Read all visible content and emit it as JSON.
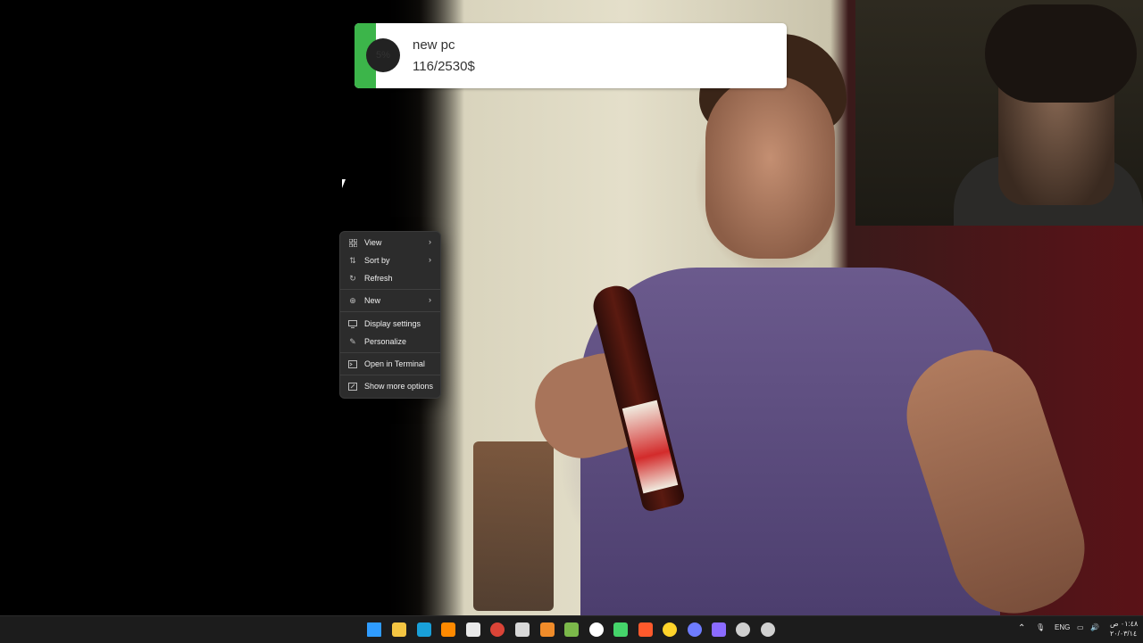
{
  "widget": {
    "percent": "5%",
    "title": "new pc",
    "amount": "116/2530$",
    "progress": 0.05
  },
  "context_menu": {
    "items": [
      {
        "label": "View",
        "icon": "view-grid-icon",
        "submenu": true
      },
      {
        "label": "Sort by",
        "icon": "sort-icon",
        "submenu": true
      },
      {
        "label": "Refresh",
        "icon": "refresh-icon",
        "submenu": false
      },
      {
        "label": "New",
        "icon": "new-plus-icon",
        "submenu": true
      },
      {
        "label": "Display settings",
        "icon": "display-icon",
        "submenu": false
      },
      {
        "label": "Personalize",
        "icon": "pen-icon",
        "submenu": false
      },
      {
        "label": "Open in Terminal",
        "icon": "terminal-icon",
        "submenu": false
      },
      {
        "label": "Show more options",
        "icon": "more-options-icon",
        "submenu": false
      }
    ]
  },
  "taskbar": {
    "apps": [
      {
        "name": "start",
        "icon": "windows-start-icon",
        "color": "#2f9cff"
      },
      {
        "name": "file-explorer",
        "icon": "folder-icon",
        "color": "#f4c542"
      },
      {
        "name": "edge",
        "icon": "edge-icon",
        "color": "#19a0d9"
      },
      {
        "name": "illustrator",
        "icon": "illustrator-icon",
        "color": "#ff8a00"
      },
      {
        "name": "store",
        "icon": "store-icon",
        "color": "#e9e9e9"
      },
      {
        "name": "chrome",
        "icon": "chrome-icon",
        "color": "#db4437"
      },
      {
        "name": "7zip",
        "icon": "7zip-icon",
        "color": "#d8d8d8"
      },
      {
        "name": "blender",
        "icon": "blender-icon",
        "color": "#f08c2a"
      },
      {
        "name": "layers-app",
        "icon": "layers-icon",
        "color": "#7bb84a"
      },
      {
        "name": "chat-app",
        "icon": "chat-bubble-icon",
        "color": "#ffffff"
      },
      {
        "name": "app-lambda",
        "icon": "lambda-icon",
        "color": "#45d46a"
      },
      {
        "name": "brave",
        "icon": "brave-icon",
        "color": "#ff5a2c"
      },
      {
        "name": "yellow-app",
        "icon": "yellow-circle-icon",
        "color": "#ffd42a"
      },
      {
        "name": "discord",
        "icon": "discord-icon",
        "color": "#6e7cff"
      },
      {
        "name": "app-a",
        "icon": "letter-a-icon",
        "color": "#8b6bff"
      },
      {
        "name": "obs",
        "icon": "obs-icon",
        "color": "#cfcfcf"
      },
      {
        "name": "settings",
        "icon": "gear-icon",
        "color": "#d0d0d0"
      }
    ],
    "tray": {
      "language": "ENG",
      "time": "٠١:٤٨ ص",
      "date": "٢٠/٠٣/١٤"
    }
  }
}
